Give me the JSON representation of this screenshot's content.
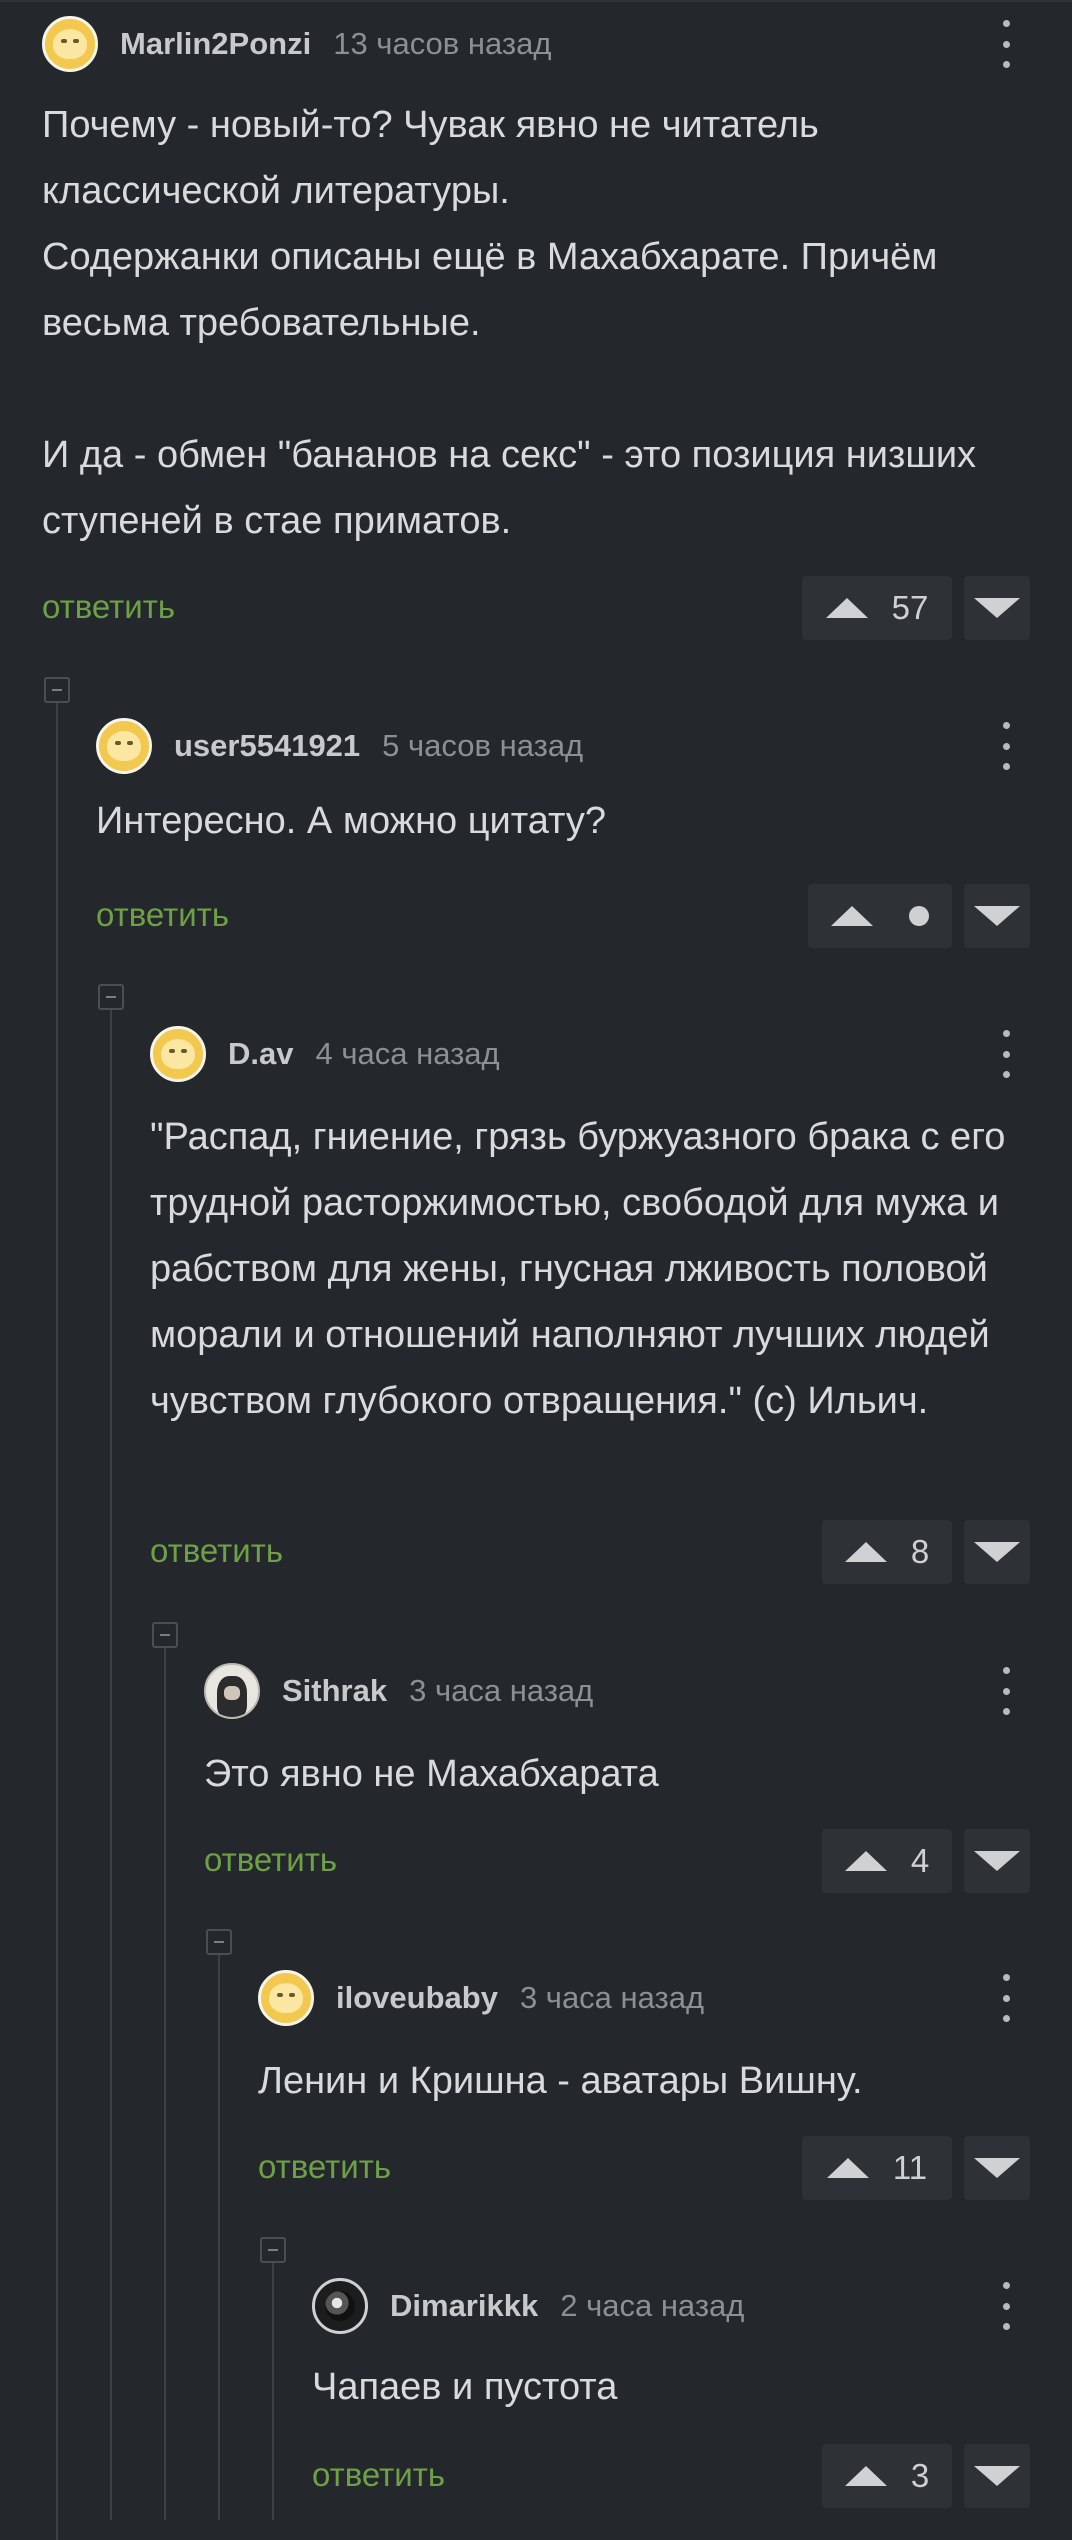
{
  "comments": [
    {
      "username": "Marlin2Ponzi",
      "time": "13 часов назад",
      "avatar": "default-avatar-icon",
      "text": "Почему - новый-то? Чувак явно не читатель классической литературы.\nСодержанки описаны ещё в Махабхарате. Причём весьма требовательные.\n\nИ да - обмен \"бананов на секс\" - это позиция низших ступеней в стае приматов.",
      "reply_label": "ответить",
      "score": "57"
    },
    {
      "username": "user5541921",
      "time": "5 часов назад",
      "avatar": "default-avatar-icon",
      "text": "Интересно. А можно цитату?",
      "reply_label": "ответить",
      "score": "●"
    },
    {
      "username": "D.av",
      "time": "4 часа назад",
      "avatar": "default-avatar-icon",
      "text": "\"Распад, гниение, грязь буржуазного брака с его трудной расторжимостью, свободой для мужа и рабством для жены, гнусная лживость половой морали и отношений наполняют лучших людей чувством глубокого отвращения.\" (с) Ильич.",
      "reply_label": "ответить",
      "score": "8"
    },
    {
      "username": "Sithrak",
      "time": "3 часа назад",
      "avatar": "sithrak-avatar-icon",
      "text": "Это явно не Махабхарата",
      "reply_label": "ответить",
      "score": "4"
    },
    {
      "username": "iloveubaby",
      "time": "3 часа назад",
      "avatar": "default-avatar-icon",
      "text": "Ленин и Кришна - аватары Вишну.",
      "reply_label": "ответить",
      "score": "11"
    },
    {
      "username": "Dimarikkk",
      "time": "2 часа назад",
      "avatar": "dimarikkk-avatar-icon",
      "text": "Чапаев и пустота",
      "reply_label": "ответить",
      "score": "3"
    }
  ],
  "colors": {
    "background": "#24272b",
    "reply_link": "#6ea046",
    "vote_box": "#2e3135",
    "username": "#c8c9cb",
    "timestamp": "#8c8f94"
  }
}
